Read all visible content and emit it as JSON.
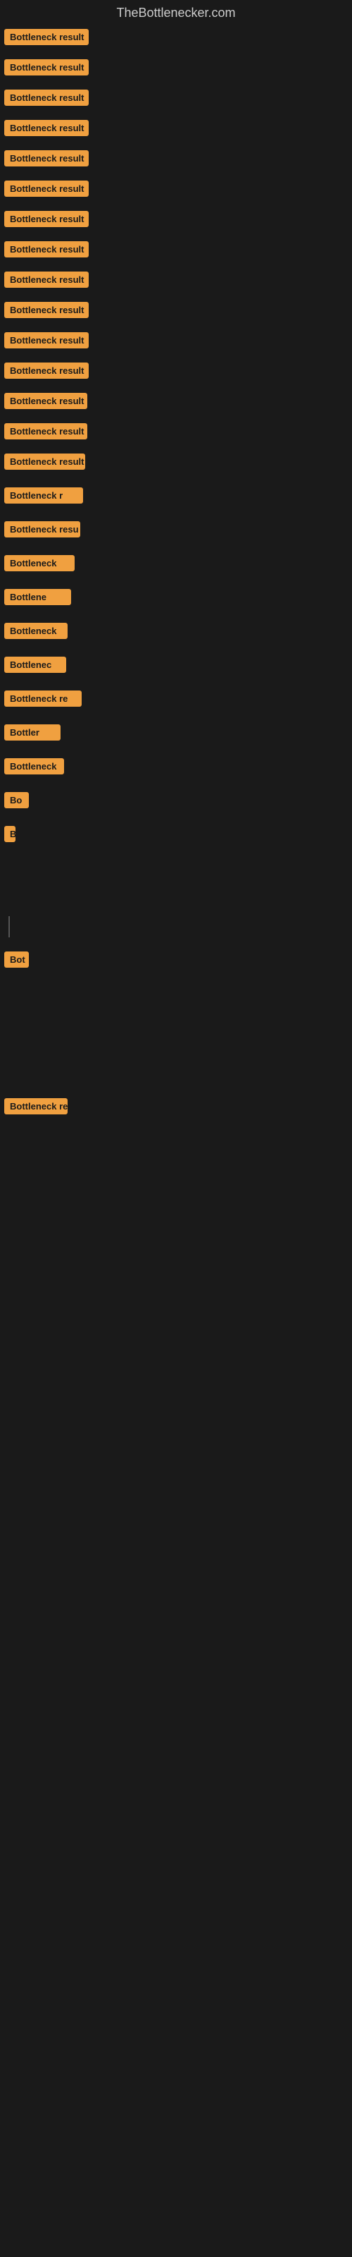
{
  "site": {
    "title": "TheBottlenecker.com"
  },
  "items": [
    {
      "id": 1,
      "label": "Bottleneck result"
    },
    {
      "id": 2,
      "label": "Bottleneck result"
    },
    {
      "id": 3,
      "label": "Bottleneck result"
    },
    {
      "id": 4,
      "label": "Bottleneck result"
    },
    {
      "id": 5,
      "label": "Bottleneck result"
    },
    {
      "id": 6,
      "label": "Bottleneck result"
    },
    {
      "id": 7,
      "label": "Bottleneck result"
    },
    {
      "id": 8,
      "label": "Bottleneck result"
    },
    {
      "id": 9,
      "label": "Bottleneck result"
    },
    {
      "id": 10,
      "label": "Bottleneck result"
    },
    {
      "id": 11,
      "label": "Bottleneck result"
    },
    {
      "id": 12,
      "label": "Bottleneck result"
    },
    {
      "id": 13,
      "label": "Bottleneck result"
    },
    {
      "id": 14,
      "label": "Bottleneck result"
    },
    {
      "id": 15,
      "label": "Bottleneck result"
    },
    {
      "id": 16,
      "label": "Bottleneck r"
    },
    {
      "id": 17,
      "label": "Bottleneck resu"
    },
    {
      "id": 18,
      "label": "Bottleneck"
    },
    {
      "id": 19,
      "label": "Bottlene"
    },
    {
      "id": 20,
      "label": "Bottleneck"
    },
    {
      "id": 21,
      "label": "Bottlenec"
    },
    {
      "id": 22,
      "label": "Bottleneck re"
    },
    {
      "id": 23,
      "label": "Bottler"
    },
    {
      "id": 24,
      "label": "Bottleneck"
    },
    {
      "id": 25,
      "label": "Bo"
    },
    {
      "id": 26,
      "label": "B"
    },
    {
      "id": 27,
      "label": ""
    },
    {
      "id": 28,
      "label": ""
    },
    {
      "id": 29,
      "label": "|"
    },
    {
      "id": 30,
      "label": "Bot"
    },
    {
      "id": 31,
      "label": ""
    },
    {
      "id": 32,
      "label": ""
    },
    {
      "id": 33,
      "label": ""
    },
    {
      "id": 34,
      "label": ""
    },
    {
      "id": 35,
      "label": "Bottleneck re"
    }
  ]
}
